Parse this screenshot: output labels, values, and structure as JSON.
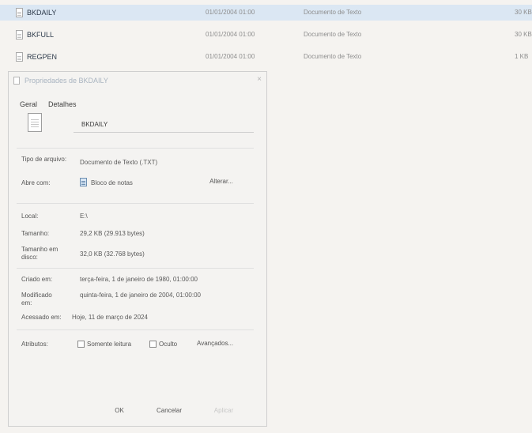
{
  "files": [
    {
      "name": "BKDAILY",
      "modified": "01/01/2004 01:00",
      "type": "Documento de Texto",
      "size": "30 KB",
      "selected": true
    },
    {
      "name": "BKFULL",
      "modified": "01/01/2004 01:00",
      "type": "Documento de Texto",
      "size": "30 KB",
      "selected": false
    },
    {
      "name": "REGPEN",
      "modified": "01/01/2004 01:00",
      "type": "Documento de Texto",
      "size": "1 KB",
      "selected": false
    }
  ],
  "dialog": {
    "title": "Propriedades de BKDAILY",
    "close_label": "×",
    "tabs": {
      "general": "Geral",
      "details": "Detalhes"
    },
    "file_name": "BKDAILY",
    "labels": {
      "type": "Tipo de arquivo:",
      "opens_with": "Abre com:",
      "location": "Local:",
      "size": "Tamanho:",
      "size_on_disk": "Tamanho em disco:",
      "created": "Criado em:",
      "modified": "Modificado em:",
      "accessed": "Acessado em:",
      "attributes": "Atributos:"
    },
    "values": {
      "type": "Documento de Texto (.TXT)",
      "opens_with": "Bloco de notas",
      "location": "E:\\",
      "size": "29,2 KB (29.913 bytes)",
      "size_on_disk": "32,0 KB (32.768 bytes)",
      "created": "terça-feira, 1 de janeiro de 1980, 01:00:00",
      "modified": "quinta-feira, 1 de janeiro de 2004, 01:00:00",
      "accessed": "Hoje, 11 de março de 2024"
    },
    "buttons": {
      "change": "Alterar...",
      "advanced": "Avançados...",
      "ok": "OK",
      "cancel": "Cancelar",
      "apply": "Aplicar"
    },
    "attributes": {
      "readonly_label": "Somente leitura",
      "hidden_label": "Oculto"
    }
  }
}
